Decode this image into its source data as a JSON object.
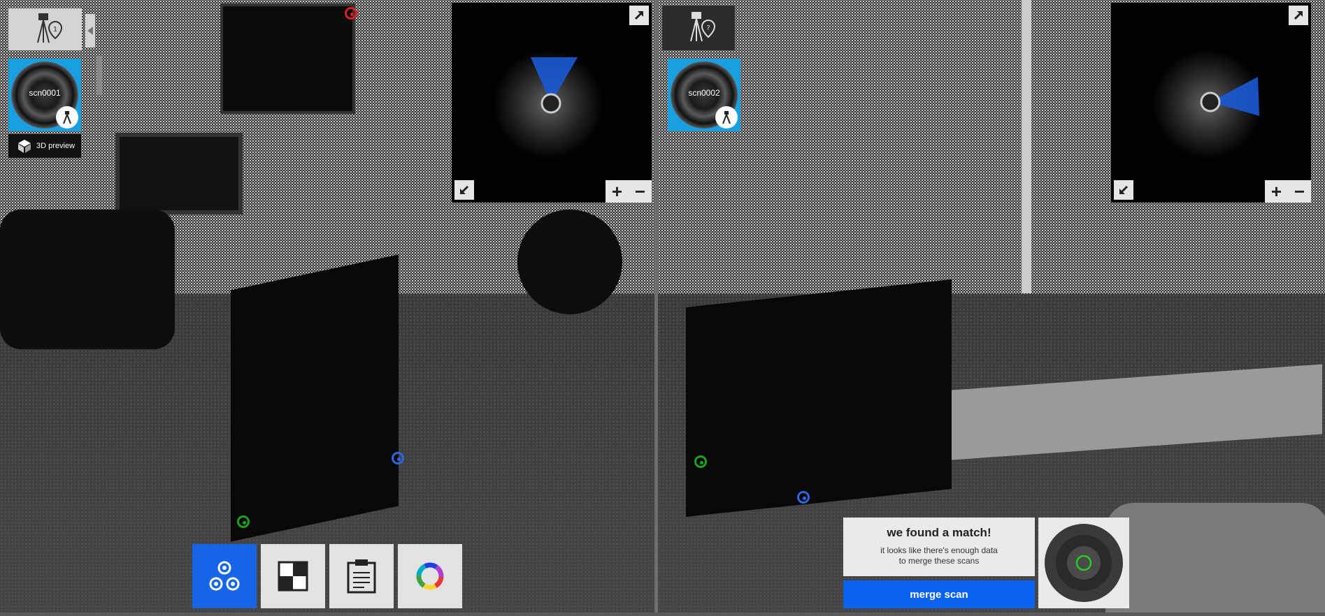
{
  "left_pane": {
    "scan_label": "scn0001",
    "scan_number": "1",
    "preview_label": "3D preview"
  },
  "right_pane": {
    "scan_label": "scn0002",
    "scan_number": "?"
  },
  "toolbar": {
    "tools": [
      "cluster-view-icon",
      "checkerboard-icon",
      "clipboard-icon",
      "color-wheel-icon"
    ]
  },
  "match_panel": {
    "title": "we found a match!",
    "body_line1": "it looks like there's enough data",
    "body_line2": "to merge these scans",
    "merge_label": "merge scan"
  },
  "minimap": {
    "zoom_in": "+",
    "zoom_out": "−"
  },
  "colors": {
    "accent_blue": "#1565e6",
    "thumb_blue": "#1a9fe0",
    "marker_blue": "#2d67e0",
    "marker_green": "#1aa31a",
    "marker_red": "#d62222"
  }
}
